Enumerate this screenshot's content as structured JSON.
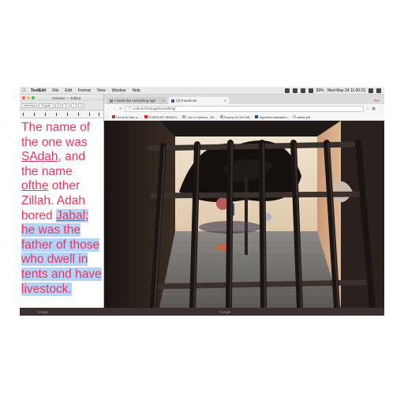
{
  "menubar": {
    "app_name": "TextEdit",
    "items": [
      "File",
      "Edit",
      "Format",
      "View",
      "Window",
      "Help"
    ],
    "clock": "Wed May 24  11:00:23",
    "battery": "39%"
  },
  "textedit": {
    "title": "Genesis — Edited",
    "font_name": "Helvetica",
    "font_style": "Regular",
    "body_plain_1": "The name of the one was ",
    "body_u1": "SAdah",
    "body_plain_2": ", and the name ",
    "body_u2": "ofthe",
    "body_plain_3": " other Zillah. Adah bored ",
    "body_sel_u": "Jabal;",
    "body_sel": " he was the father of those who dwell in tents and have livestock."
  },
  "browser": {
    "tabs": [
      {
        "label": "I kinda like everything.ngit"
      },
      {
        "label": "(3) Facebook"
      }
    ],
    "profile": "Tim",
    "url": "void.technology/everything/",
    "bookmarks": [
      "Trump At Mar-a-...",
      "STARSHIP GENIUS...",
      "I Am a Camera - Wi...",
      "Society for the Diff...",
      "HyperNormalisation...",
      "carlsa.pdf"
    ]
  },
  "dock": {
    "left_label": "Google",
    "mid_label": "Google"
  },
  "colors": {
    "text_pink": "#e8365f",
    "selection": "#b4d3f7",
    "menubar": "#e9e9e9"
  }
}
